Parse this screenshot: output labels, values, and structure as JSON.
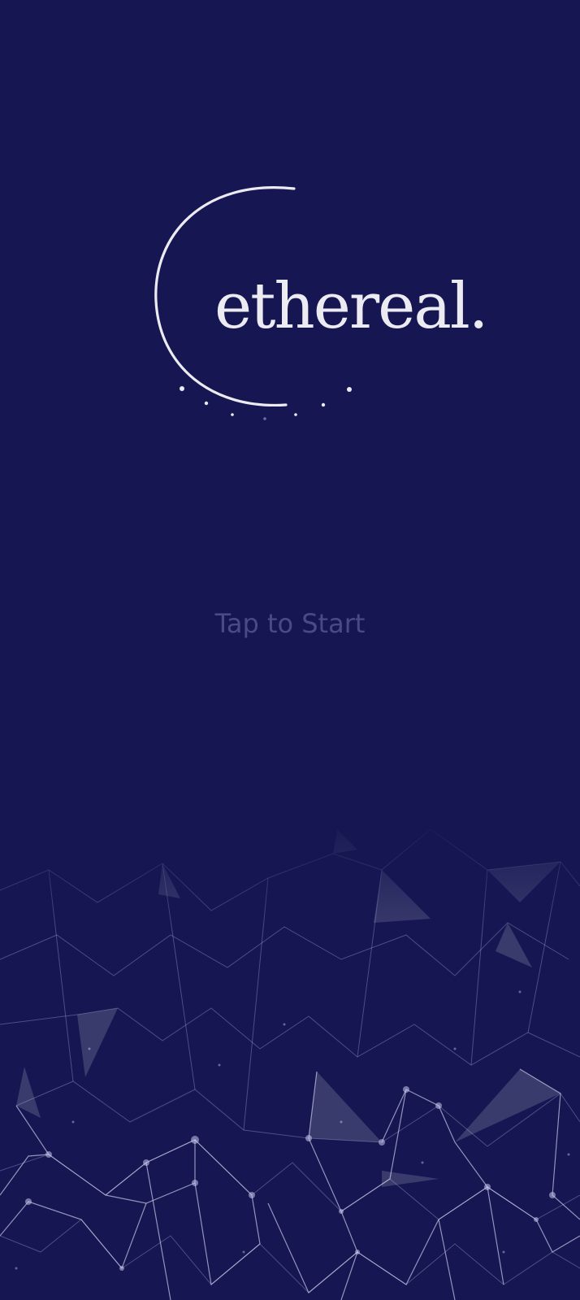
{
  "logo": {
    "word": "ethereal."
  },
  "start": {
    "label": "Tap to Start"
  },
  "colors": {
    "background": "#151652",
    "logo": "#ecebf2",
    "start_text": "#4a4b85"
  },
  "icons": {
    "logo_mark": "crescent-moon-icon",
    "background_art": "polygon-network-icon"
  }
}
